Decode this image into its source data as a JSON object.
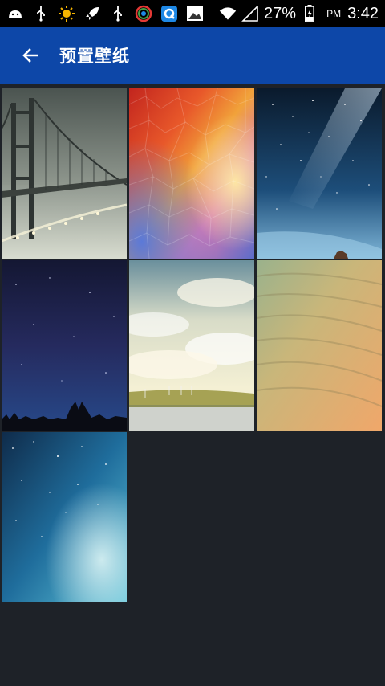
{
  "status_bar": {
    "battery": "27%",
    "ampm": "PM",
    "time": "3:42"
  },
  "app_bar": {
    "title": "预置壁纸"
  },
  "wallpapers": [
    {
      "name": "bridge"
    },
    {
      "name": "polygon-colors"
    },
    {
      "name": "milky-way"
    },
    {
      "name": "night-forest"
    },
    {
      "name": "wind-farm"
    },
    {
      "name": "sand-dune"
    },
    {
      "name": "nebula"
    }
  ],
  "colors": {
    "status_bar_bg": "#000000",
    "app_bar_bg": "#0d47a8",
    "page_bg": "#1e2228"
  }
}
